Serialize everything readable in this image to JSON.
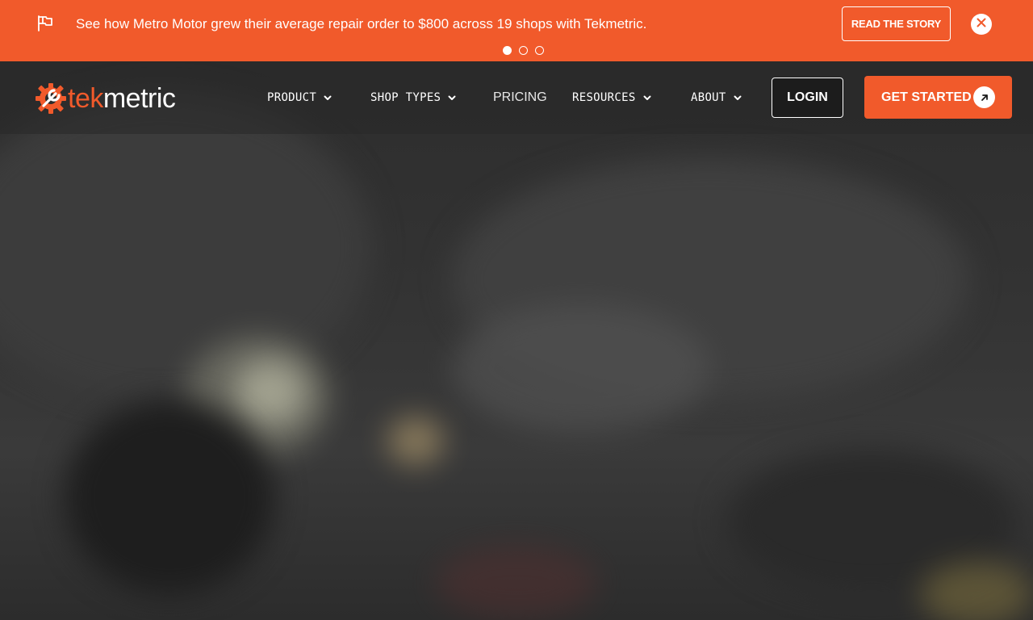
{
  "banner": {
    "message": "See how Metro Motor grew their average repair order to $800 across 19 shops with Tekmetric.",
    "cta_label": "READ THE STORY",
    "carousel": {
      "total": 3,
      "active_index": 0
    },
    "icons": {
      "flag": "flag-icon",
      "close": "close-icon"
    },
    "color": "#f15a2b"
  },
  "logo": {
    "part1": "tek",
    "part2": "metric",
    "icon": "gear-wrench-icon"
  },
  "nav": {
    "items": [
      {
        "label": "PRODUCT",
        "has_dropdown": true
      },
      {
        "label": "SHOP TYPES",
        "has_dropdown": true
      },
      {
        "label": "PRICING",
        "has_dropdown": false
      },
      {
        "label": "RESOURCES",
        "has_dropdown": true
      },
      {
        "label": "ABOUT",
        "has_dropdown": true
      }
    ],
    "login_label": "LOGIN",
    "get_started_label": "GET STARTED",
    "get_started_icon": "arrow-up-right-icon"
  },
  "colors": {
    "accent": "#f15a2b",
    "nav_bg": "#2b2b2b",
    "text": "#ffffff"
  }
}
